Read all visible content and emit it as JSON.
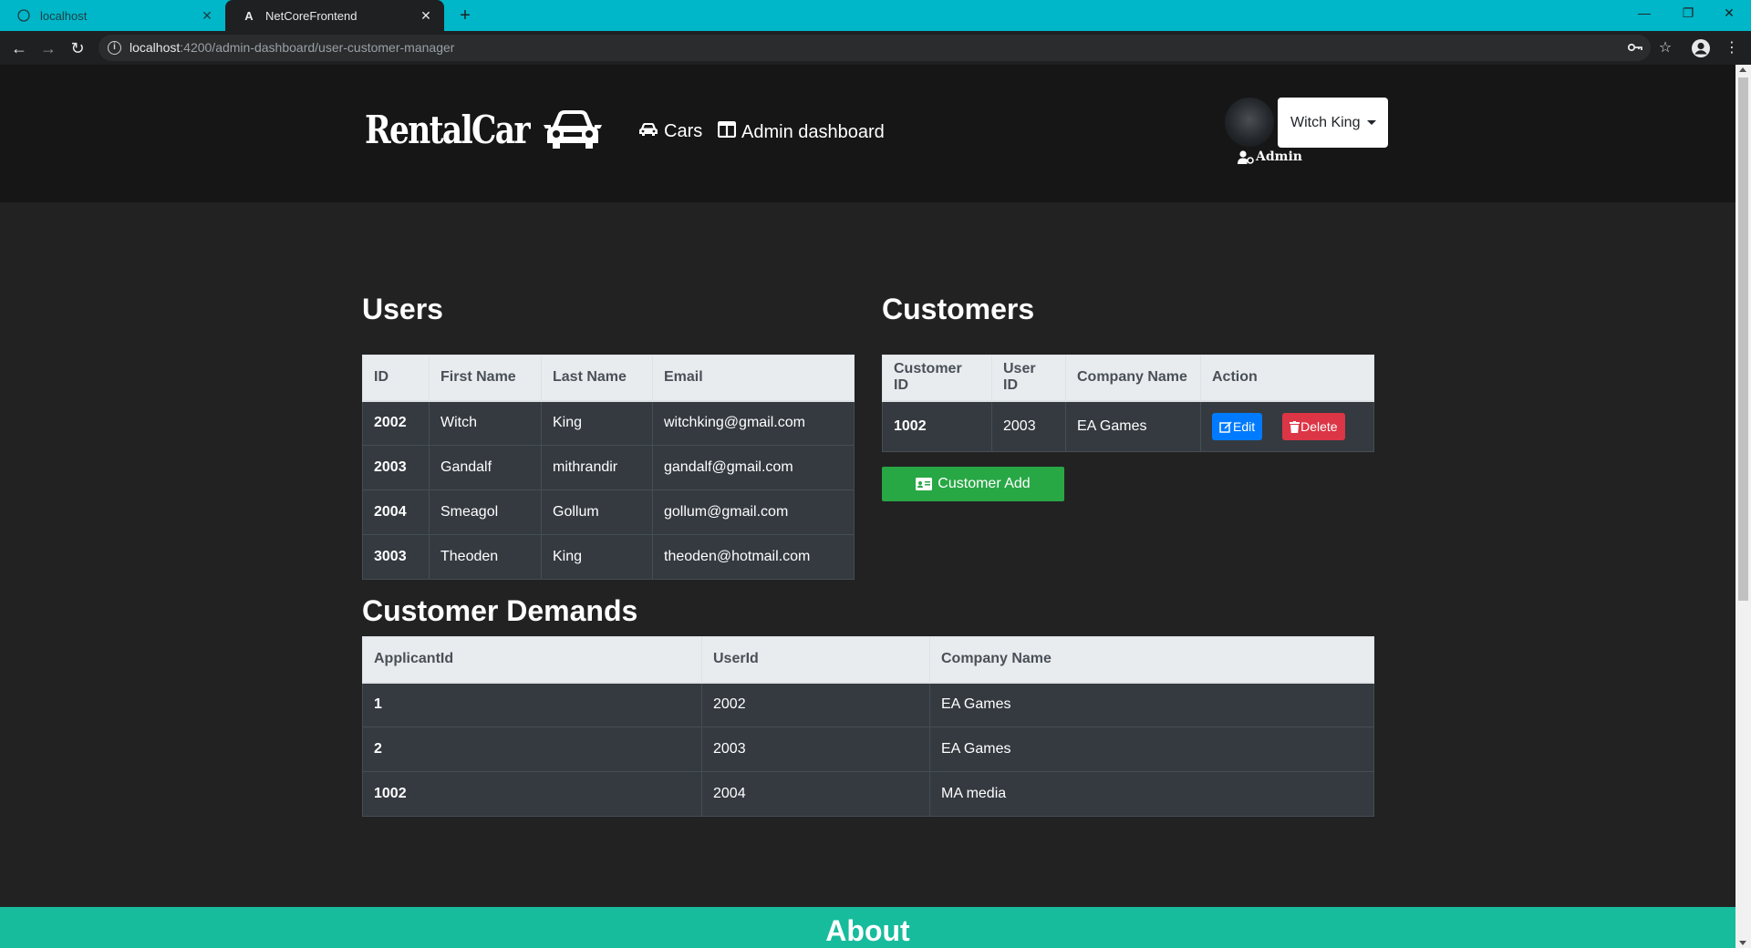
{
  "browser": {
    "tabs": [
      {
        "title": "localhost",
        "close": "✕"
      },
      {
        "title": "NetCoreFrontend",
        "close": "✕"
      }
    ],
    "url_host": "localhost",
    "url_path": ":4200/admin-dashboard/user-customer-manager"
  },
  "nav": {
    "logo_text": "RentalCar",
    "cars_label": "Cars",
    "admin_dashboard_label": "Admin dashboard",
    "user_name": "Witch King",
    "role": "Admin"
  },
  "users": {
    "title": "Users",
    "columns": [
      "ID",
      "First Name",
      "Last Name",
      "Email"
    ],
    "rows": [
      [
        "2002",
        "Witch",
        "King",
        "witchking@gmail.com"
      ],
      [
        "2003",
        "Gandalf",
        "mithrandir",
        "gandalf@gmail.com"
      ],
      [
        "2004",
        "Smeagol",
        "Gollum",
        "gollum@gmail.com"
      ],
      [
        "3003",
        "Theoden",
        "King",
        "theoden@hotmail.com"
      ]
    ]
  },
  "customers": {
    "title": "Customers",
    "columns": [
      "Customer ID",
      "User ID",
      "Company Name",
      "Action"
    ],
    "rows": [
      [
        "1002",
        "2003",
        "EA Games"
      ]
    ],
    "edit_label": "Edit",
    "delete_label": "Delete",
    "add_label": "Customer Add"
  },
  "demands": {
    "title": "Customer Demands",
    "columns": [
      "ApplicantId",
      "UserId",
      "Company Name"
    ],
    "rows": [
      [
        "1",
        "2002",
        "EA Games"
      ],
      [
        "2",
        "2003",
        "EA Games"
      ],
      [
        "1002",
        "2004",
        "MA media"
      ]
    ]
  },
  "footer": {
    "about": "About"
  },
  "colors": {
    "tabbar": "#00b6c9",
    "page_bg": "#222222",
    "header_bg": "#161616",
    "table_row": "#343a40",
    "edit": "#007bff",
    "delete": "#dc3545",
    "add": "#28a745",
    "footer": "#17bc9c"
  }
}
